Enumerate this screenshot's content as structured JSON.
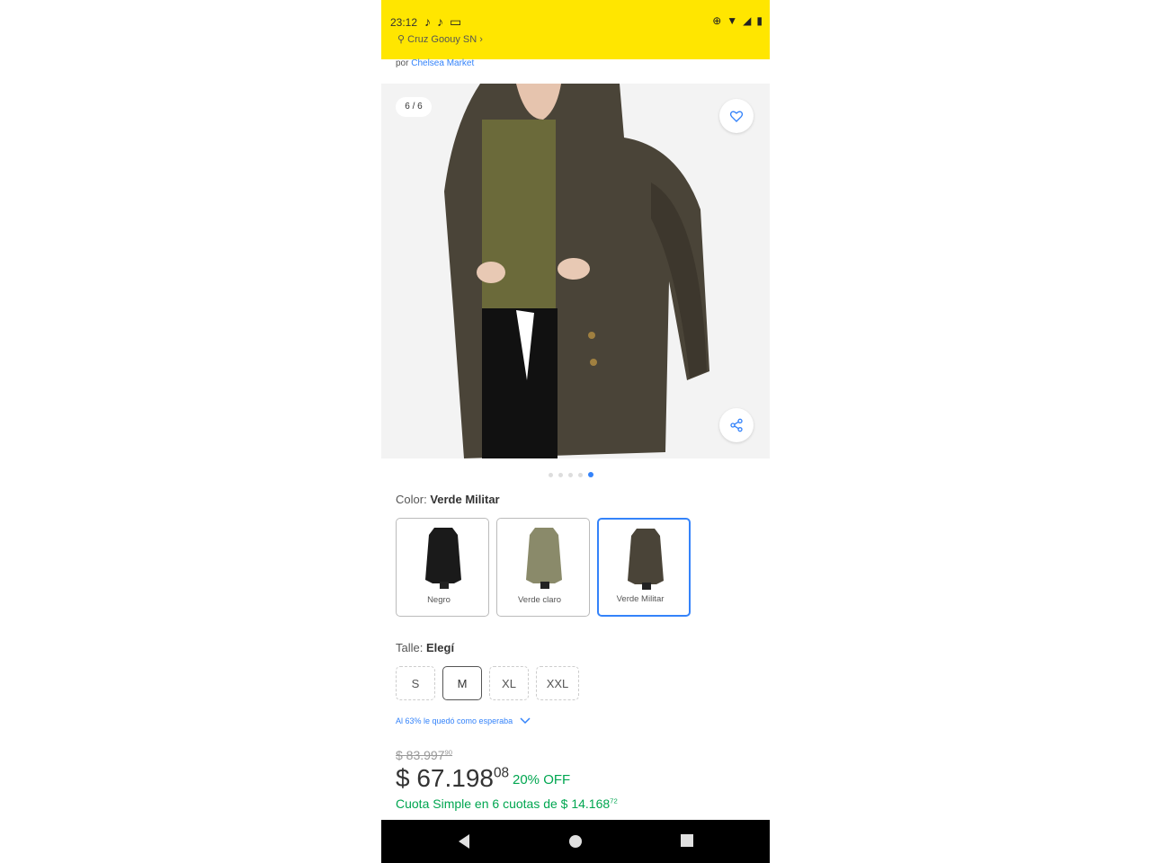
{
  "status_bar": {
    "time": "23:12"
  },
  "header": {
    "location": "Cruz Goouy SN",
    "seller_prefix": "por",
    "seller_name": "Chelsea Market"
  },
  "gallery": {
    "counter": "6 / 6",
    "dots_total": 5,
    "dot_active": 5
  },
  "color": {
    "label": "Color:",
    "selected": "Verde Militar",
    "options": [
      "Negro",
      "Verde claro",
      "Verde Militar"
    ]
  },
  "size": {
    "label": "Talle:",
    "selected": "Elegí",
    "options": [
      "S",
      "M",
      "XL",
      "XXL"
    ]
  },
  "fit_note": "Al 63% le quedó como esperaba",
  "pricing": {
    "old_price": "$ 83.997",
    "old_price_cents": "90",
    "price": "$ 67.198",
    "price_cents": "08",
    "discount": "20% OFF",
    "installments": "Cuota Simple en 6 cuotas de $ 14.168",
    "installments_cents": "72"
  },
  "colors": {
    "accent": "#3483fa",
    "brand_yellow": "#ffe600",
    "green": "#00a650"
  }
}
